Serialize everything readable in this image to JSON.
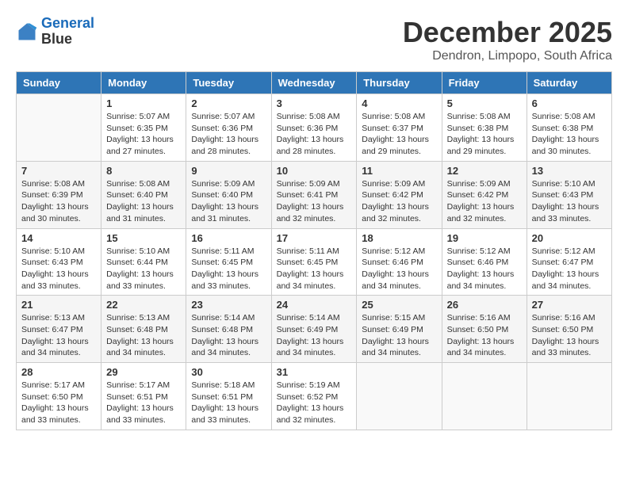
{
  "app": {
    "logo_line1": "General",
    "logo_line2": "Blue"
  },
  "header": {
    "month_year": "December 2025",
    "location": "Dendron, Limpopo, South Africa"
  },
  "weekdays": [
    "Sunday",
    "Monday",
    "Tuesday",
    "Wednesday",
    "Thursday",
    "Friday",
    "Saturday"
  ],
  "weeks": [
    [
      {
        "day": "",
        "info": ""
      },
      {
        "day": "1",
        "info": "Sunrise: 5:07 AM\nSunset: 6:35 PM\nDaylight: 13 hours\nand 27 minutes."
      },
      {
        "day": "2",
        "info": "Sunrise: 5:07 AM\nSunset: 6:36 PM\nDaylight: 13 hours\nand 28 minutes."
      },
      {
        "day": "3",
        "info": "Sunrise: 5:08 AM\nSunset: 6:36 PM\nDaylight: 13 hours\nand 28 minutes."
      },
      {
        "day": "4",
        "info": "Sunrise: 5:08 AM\nSunset: 6:37 PM\nDaylight: 13 hours\nand 29 minutes."
      },
      {
        "day": "5",
        "info": "Sunrise: 5:08 AM\nSunset: 6:38 PM\nDaylight: 13 hours\nand 29 minutes."
      },
      {
        "day": "6",
        "info": "Sunrise: 5:08 AM\nSunset: 6:38 PM\nDaylight: 13 hours\nand 30 minutes."
      }
    ],
    [
      {
        "day": "7",
        "info": "Sunrise: 5:08 AM\nSunset: 6:39 PM\nDaylight: 13 hours\nand 30 minutes."
      },
      {
        "day": "8",
        "info": "Sunrise: 5:08 AM\nSunset: 6:40 PM\nDaylight: 13 hours\nand 31 minutes."
      },
      {
        "day": "9",
        "info": "Sunrise: 5:09 AM\nSunset: 6:40 PM\nDaylight: 13 hours\nand 31 minutes."
      },
      {
        "day": "10",
        "info": "Sunrise: 5:09 AM\nSunset: 6:41 PM\nDaylight: 13 hours\nand 32 minutes."
      },
      {
        "day": "11",
        "info": "Sunrise: 5:09 AM\nSunset: 6:42 PM\nDaylight: 13 hours\nand 32 minutes."
      },
      {
        "day": "12",
        "info": "Sunrise: 5:09 AM\nSunset: 6:42 PM\nDaylight: 13 hours\nand 32 minutes."
      },
      {
        "day": "13",
        "info": "Sunrise: 5:10 AM\nSunset: 6:43 PM\nDaylight: 13 hours\nand 33 minutes."
      }
    ],
    [
      {
        "day": "14",
        "info": "Sunrise: 5:10 AM\nSunset: 6:43 PM\nDaylight: 13 hours\nand 33 minutes."
      },
      {
        "day": "15",
        "info": "Sunrise: 5:10 AM\nSunset: 6:44 PM\nDaylight: 13 hours\nand 33 minutes."
      },
      {
        "day": "16",
        "info": "Sunrise: 5:11 AM\nSunset: 6:45 PM\nDaylight: 13 hours\nand 33 minutes."
      },
      {
        "day": "17",
        "info": "Sunrise: 5:11 AM\nSunset: 6:45 PM\nDaylight: 13 hours\nand 34 minutes."
      },
      {
        "day": "18",
        "info": "Sunrise: 5:12 AM\nSunset: 6:46 PM\nDaylight: 13 hours\nand 34 minutes."
      },
      {
        "day": "19",
        "info": "Sunrise: 5:12 AM\nSunset: 6:46 PM\nDaylight: 13 hours\nand 34 minutes."
      },
      {
        "day": "20",
        "info": "Sunrise: 5:12 AM\nSunset: 6:47 PM\nDaylight: 13 hours\nand 34 minutes."
      }
    ],
    [
      {
        "day": "21",
        "info": "Sunrise: 5:13 AM\nSunset: 6:47 PM\nDaylight: 13 hours\nand 34 minutes."
      },
      {
        "day": "22",
        "info": "Sunrise: 5:13 AM\nSunset: 6:48 PM\nDaylight: 13 hours\nand 34 minutes."
      },
      {
        "day": "23",
        "info": "Sunrise: 5:14 AM\nSunset: 6:48 PM\nDaylight: 13 hours\nand 34 minutes."
      },
      {
        "day": "24",
        "info": "Sunrise: 5:14 AM\nSunset: 6:49 PM\nDaylight: 13 hours\nand 34 minutes."
      },
      {
        "day": "25",
        "info": "Sunrise: 5:15 AM\nSunset: 6:49 PM\nDaylight: 13 hours\nand 34 minutes."
      },
      {
        "day": "26",
        "info": "Sunrise: 5:16 AM\nSunset: 6:50 PM\nDaylight: 13 hours\nand 34 minutes."
      },
      {
        "day": "27",
        "info": "Sunrise: 5:16 AM\nSunset: 6:50 PM\nDaylight: 13 hours\nand 33 minutes."
      }
    ],
    [
      {
        "day": "28",
        "info": "Sunrise: 5:17 AM\nSunset: 6:50 PM\nDaylight: 13 hours\nand 33 minutes."
      },
      {
        "day": "29",
        "info": "Sunrise: 5:17 AM\nSunset: 6:51 PM\nDaylight: 13 hours\nand 33 minutes."
      },
      {
        "day": "30",
        "info": "Sunrise: 5:18 AM\nSunset: 6:51 PM\nDaylight: 13 hours\nand 33 minutes."
      },
      {
        "day": "31",
        "info": "Sunrise: 5:19 AM\nSunset: 6:52 PM\nDaylight: 13 hours\nand 32 minutes."
      },
      {
        "day": "",
        "info": ""
      },
      {
        "day": "",
        "info": ""
      },
      {
        "day": "",
        "info": ""
      }
    ]
  ]
}
